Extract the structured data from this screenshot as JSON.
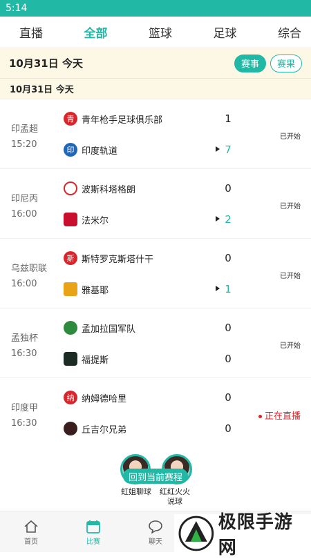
{
  "status_bar": {
    "time": "5:14"
  },
  "tabs": [
    "直播",
    "全部",
    "篮球",
    "足球",
    "综合"
  ],
  "active_tab": 1,
  "date_bar": {
    "date": "10月31日  今天",
    "btn_events": "赛事",
    "btn_results": "赛果"
  },
  "sub_date": "10月31日    今天",
  "matches": [
    {
      "league": "印孟超",
      "time": "15:20",
      "home": {
        "name": "青年枪手足球俱乐部",
        "badge": "青",
        "score": "1"
      },
      "away": {
        "name": "印度轨道",
        "badge": "印",
        "score": "7"
      },
      "status": "已开始"
    },
    {
      "league": "印尼丙",
      "time": "16:00",
      "home": {
        "name": "波斯科塔格朗",
        "badge": "",
        "score": "0"
      },
      "away": {
        "name": "法米尔",
        "badge": "",
        "score": "2"
      },
      "status": "已开始"
    },
    {
      "league": "乌兹职联",
      "time": "16:00",
      "home": {
        "name": "斯特罗克斯塔什干",
        "badge": "斯",
        "score": "0"
      },
      "away": {
        "name": "雅基耶",
        "badge": "",
        "score": "1"
      },
      "status": "已开始"
    },
    {
      "league": "孟独杯",
      "time": "16:30",
      "home": {
        "name": "孟加拉国军队",
        "badge": "",
        "score": "0"
      },
      "away": {
        "name": "福提斯",
        "badge": "",
        "score": "0"
      },
      "status": "已开始"
    },
    {
      "league": "印度甲",
      "time": "16:30",
      "home": {
        "name": "纳姆德哈里",
        "badge": "纳",
        "score": "0"
      },
      "away": {
        "name": "丘吉尔兄弟",
        "badge": "",
        "score": "0"
      },
      "status": "正在直播"
    }
  ],
  "float": {
    "back_label": "回到当前赛程",
    "host1": "虹姐聊球",
    "host2": "红红火火说球"
  },
  "bottom_nav": [
    "首页",
    "比赛",
    "聊天"
  ],
  "watermark": "极限手游网",
  "colors": {
    "accent": "#22b8a6",
    "live": "#e0242a"
  }
}
